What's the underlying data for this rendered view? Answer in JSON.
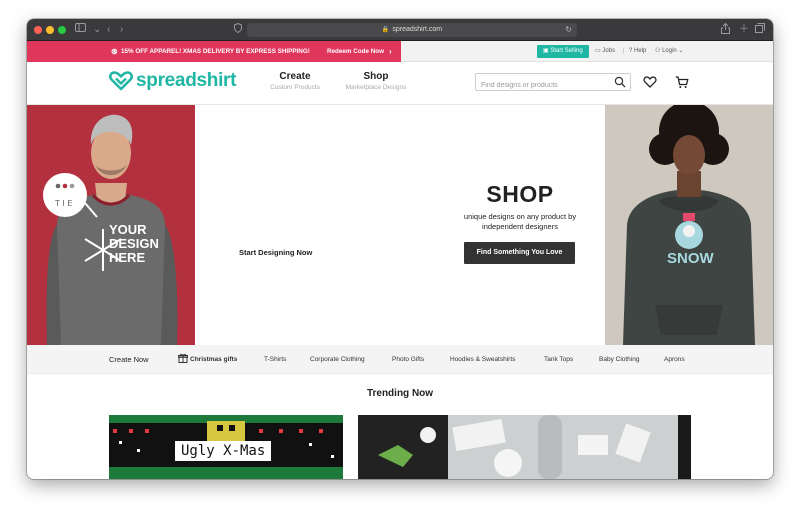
{
  "browser": {
    "url": "spreadshirt.com"
  },
  "promo": {
    "text": "15% OFF APPAREL! XMAS DELIVERY BY EXPRESS SHIPPING!",
    "redeem": "Redeem Code Now",
    "start_selling": "Start Selling",
    "jobs": "Jobs",
    "help": "Help",
    "login": "Login"
  },
  "header": {
    "brand": "spreadshirt",
    "nav": [
      {
        "label": "Create",
        "sub": "Custom Products"
      },
      {
        "label": "Shop",
        "sub": "Marketplace Designs"
      }
    ],
    "search_placeholder": "Find designs or products"
  },
  "hero": {
    "left_shirt_text": [
      "YOUR",
      "DESIGN",
      "HERE"
    ],
    "start_designing": "Start Designing Now",
    "shop_title": "SHOP",
    "shop_subtitle_line1": "unique designs on any product by",
    "shop_subtitle_line2": "independent designers",
    "cta": "Find Something You Love",
    "right_hoodie_text": "SNOW"
  },
  "categories": {
    "create_now": "Create Now",
    "items": [
      "Christmas gifts",
      "T-Shirts",
      "Corporate Clothing",
      "Photo Gifts",
      "Hoodies & Sweatshirts",
      "Tank Tops",
      "Baby Clothing",
      "Aprons"
    ]
  },
  "trending": {
    "title": "Trending Now",
    "card1_label": "Ugly X-Mas"
  },
  "colors": {
    "brand_teal": "#1fb7a4",
    "promo_pink": "#e0365c",
    "hero_left_bg": "#b3303f",
    "cta_bg": "#333333"
  }
}
